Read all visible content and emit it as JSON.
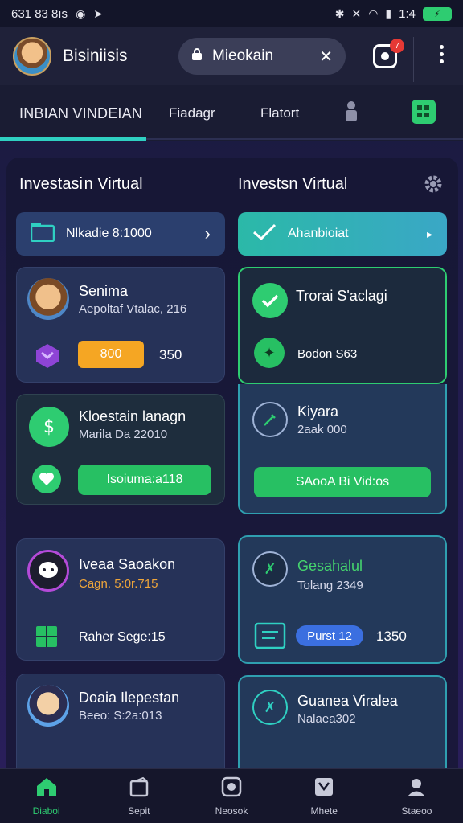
{
  "status_bar": {
    "time": "631 83 8ıs",
    "right_text": "1:4"
  },
  "app_bar": {
    "title": "Bisiniisis",
    "search_value": "Mieokain",
    "badge": "7"
  },
  "tabs": [
    {
      "label": "INBIAN VINDEIAN",
      "active": true
    },
    {
      "label": "Fiadagr"
    },
    {
      "label": "Flatort"
    }
  ],
  "left_column": {
    "title": "Investasi n Virtual",
    "top_pill": {
      "label": "Nlkadie 8:1000"
    },
    "cards": [
      {
        "name": "Senima",
        "sub": "Aepoltaf Vtalac, 216",
        "button": "800",
        "value": "350"
      },
      {
        "name": "Kloestain lanagn",
        "sub": "Marila Da 22010",
        "button": "Isoiuma:a118"
      },
      {
        "name": "Iveaa Saoakon",
        "sub": "Cagn. 5:0r.715",
        "row_text": "Raher Sege:15"
      },
      {
        "name": "Doaia Ilepestan",
        "sub": "Beeo: S:2a:013"
      }
    ]
  },
  "right_column": {
    "title": "Investsn Virtual",
    "top_pill": {
      "label": "Ahanbioiat"
    },
    "cards": [
      {
        "name": "Trorai S'aclagi",
        "row_text": "Bodon S63",
        "name2": "Kiyara",
        "sub2": "2aak 000",
        "button": "SAooA Bi Vid:os"
      },
      {
        "name": "Gesahalul",
        "sub": "Tolang 2349",
        "pill": "Purst 12",
        "value": "1350"
      },
      {
        "name": "Guanea Viralea",
        "sub": "Nalaea302"
      }
    ]
  },
  "bottom_nav": [
    {
      "label": "Diaboi",
      "active": true
    },
    {
      "label": "Sepit"
    },
    {
      "label": "Neosok"
    },
    {
      "label": "Mhete"
    },
    {
      "label": "Staeoo"
    }
  ],
  "colors": {
    "accent_green": "#2ecc71",
    "accent_teal": "#2fd0c2",
    "orange": "#f5a623"
  }
}
